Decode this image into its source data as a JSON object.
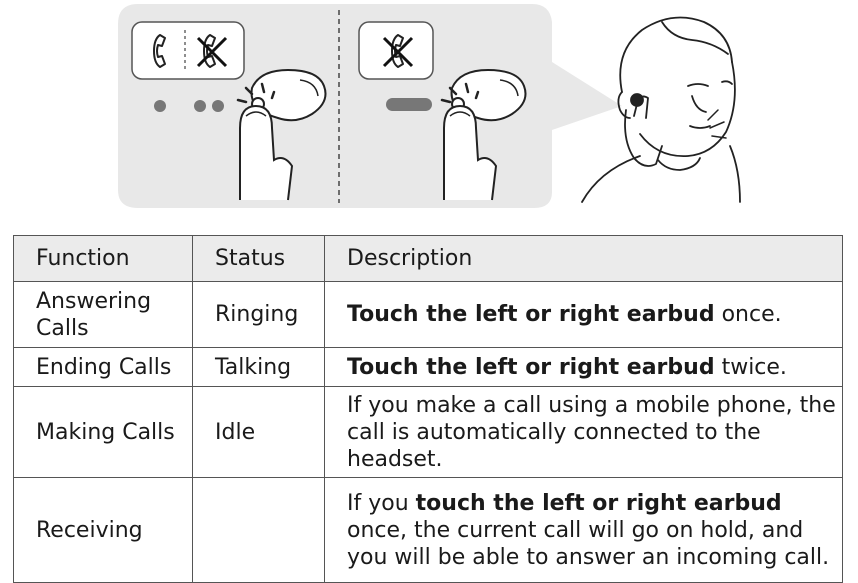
{
  "table": {
    "headers": {
      "function": "Function",
      "status": "Status",
      "description": "Description"
    },
    "rows": [
      {
        "function": "Answering Calls",
        "status": "Ringing",
        "desc_bold": "Touch the left or right earbud",
        "desc_tail": " once."
      },
      {
        "function": "Ending Calls",
        "status": "Talking",
        "desc_bold": "Touch the left or right earbud",
        "desc_tail": " twice."
      },
      {
        "function": "Making Calls",
        "status": "Idle",
        "description": "If you make a call using a mobile phone, the call is automatically connected to the headset."
      },
      {
        "function": "Receiving",
        "status": "",
        "desc_pre": "If you ",
        "desc_bold": "touch the left or right earbud",
        "desc_tail": " once, the current call will go on hold, and you will be able to answer an incoming call."
      }
    ]
  },
  "illustration": {
    "icons": [
      "phone-icon",
      "phone-crossed-icon",
      "earbud-icon",
      "finger-tap-icon",
      "person-icon"
    ]
  }
}
